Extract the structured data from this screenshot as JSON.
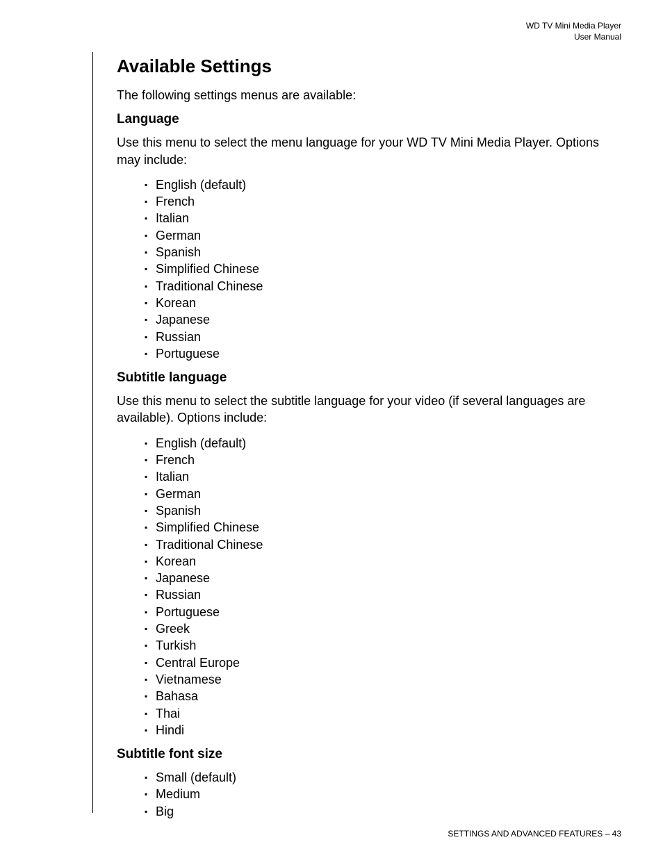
{
  "header": {
    "line1": "WD TV Mini Media Player",
    "line2": "User Manual"
  },
  "main": {
    "title": "Available Settings",
    "intro": "The following settings menus are available:",
    "sections": [
      {
        "heading": "Language",
        "body": "Use this menu to select the menu language for your WD TV Mini Media Player. Options may include:",
        "items": [
          "English (default)",
          "French",
          "Italian",
          "German",
          "Spanish",
          "Simplified Chinese",
          "Traditional Chinese",
          "Korean",
          "Japanese",
          "Russian",
          "Portuguese"
        ]
      },
      {
        "heading": "Subtitle language",
        "body": "Use this menu to select the subtitle language for your video (if several languages are available). Options include:",
        "items": [
          "English (default)",
          "French",
          "Italian",
          "German",
          "Spanish",
          "Simplified Chinese",
          "Traditional Chinese",
          "Korean",
          "Japanese",
          "Russian",
          "Portuguese",
          "Greek",
          "Turkish",
          "Central Europe",
          "Vietnamese",
          "Bahasa",
          "Thai",
          "Hindi"
        ]
      },
      {
        "heading": "Subtitle font size",
        "body": "",
        "items": [
          "Small (default)",
          "Medium",
          "Big"
        ]
      }
    ]
  },
  "footer": "SETTINGS AND ADVANCED FEATURES – 43"
}
